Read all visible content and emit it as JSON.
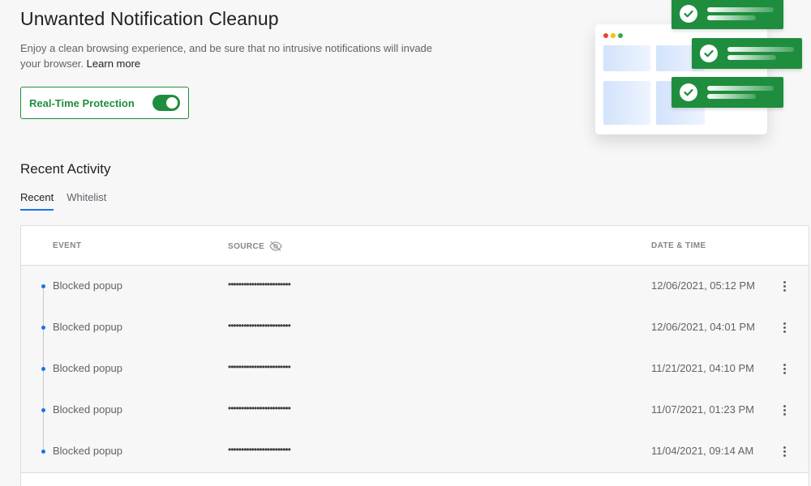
{
  "header": {
    "title": "Unwanted Notification Cleanup",
    "description": "Enjoy a clean browsing experience, and be sure that no intrusive notifications will invade your browser.",
    "learn_more": "Learn more"
  },
  "protection": {
    "label": "Real-Time Protection",
    "enabled": true,
    "accent": "#1e8e3e"
  },
  "activity": {
    "title": "Recent Activity",
    "tabs": [
      {
        "label": "Recent",
        "active": true
      },
      {
        "label": "Whitelist",
        "active": false
      }
    ],
    "columns": {
      "event": "EVENT",
      "source": "SOURCE",
      "source_icon": "eye-off-icon",
      "datetime": "DATE & TIME"
    },
    "rows": [
      {
        "event": "Blocked popup",
        "source": "••••••••••••••••••••••••",
        "datetime": "12/06/2021, 05:12 PM"
      },
      {
        "event": "Blocked popup",
        "source": "••••••••••••••••••••••••",
        "datetime": "12/06/2021, 04:01 PM"
      },
      {
        "event": "Blocked popup",
        "source": "••••••••••••••••••••••••",
        "datetime": "11/21/2021, 04:10 PM"
      },
      {
        "event": "Blocked popup",
        "source": "••••••••••••••••••••••••",
        "datetime": "11/07/2021, 01:23 PM"
      },
      {
        "event": "Blocked popup",
        "source": "••••••••••••••••••••••••",
        "datetime": "11/04/2021, 09:14 AM"
      }
    ],
    "row_action_icon": "more-vert-icon",
    "timeline_color": "#1a73e8"
  }
}
